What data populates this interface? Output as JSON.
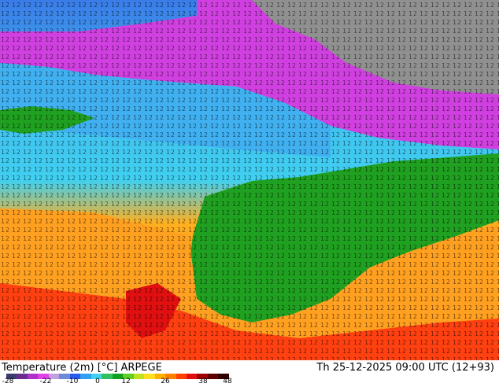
{
  "map": {
    "title": "Temperature (2m) [°C] ARPEGE",
    "timestamp": "Th 25-12-2025 09:00 UTC (12+93)",
    "legend": {
      "ticks": [
        "-28",
        "-22",
        "-10",
        "0",
        "12",
        "26",
        "38",
        "48"
      ],
      "colors": [
        "#3b3b6f",
        "#6a2a8f",
        "#b030c8",
        "#e040e8",
        "#c0a0e0",
        "#6a8ad8",
        "#2a5af0",
        "#30a0f0",
        "#40d0f0",
        "#30c060",
        "#10a020",
        "#60d020",
        "#c0e020",
        "#ffe020",
        "#ffb000",
        "#ff8000",
        "#ff4000",
        "#e01010",
        "#a00000",
        "#600000",
        "#300000"
      ]
    },
    "regions": {
      "cold_color": "#d040e0",
      "cool_color": "#40c0f0",
      "mild_color": "#20a020",
      "warm_color": "#ffa020",
      "hot_color": "#ff4010",
      "ice_color": "#909090"
    }
  }
}
